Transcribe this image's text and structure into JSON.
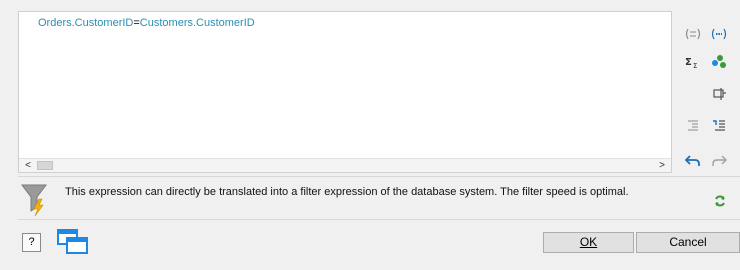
{
  "editor": {
    "expression_left": "Orders.CustomerID",
    "expression_operator": "=",
    "expression_right": "Customers.CustomerID",
    "scroll_left_glyph": "<",
    "scroll_right_glyph": ">"
  },
  "toolbar": {
    "icons": [
      "parentheses-icon",
      "string-literal-icon",
      "sum-function-icon",
      "variables-icon",
      "insert-field-icon",
      "outdent-icon",
      "indent-icon",
      "undo-icon",
      "redo-icon",
      "refresh-icon"
    ]
  },
  "hint": {
    "text": "This expression can directly be translated into a filter expression of the database system. The filter speed is optimal."
  },
  "footer": {
    "help_label": "?",
    "ok_label": "OK",
    "cancel_label": "Cancel"
  },
  "colors": {
    "field": "#2a8fb0",
    "accent_blue": "#1e88e5",
    "green": "#3a9a3a"
  }
}
